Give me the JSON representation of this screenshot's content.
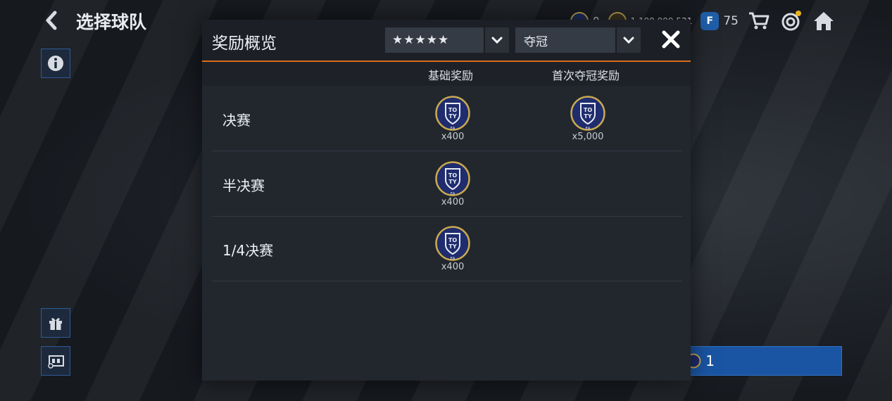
{
  "page": {
    "title": "选择球队",
    "back_icon": "chevron-left-icon"
  },
  "topbar": {
    "currencies": [
      {
        "icon": "toty-token-icon",
        "value": "0"
      },
      {
        "icon": "coin-icon",
        "value": "1,199,999,521"
      },
      {
        "icon": "fc-points-icon",
        "badge_letter": "F",
        "value": "75"
      }
    ],
    "icons": [
      "cart-icon",
      "target-icon",
      "home-icon"
    ]
  },
  "side_buttons": [
    "info-icon",
    "gift-icon",
    "match-icon"
  ],
  "background_button": {
    "value": "1"
  },
  "modal": {
    "title": "奖励概览",
    "difficulty": {
      "stars": "★★★★★",
      "rating": 5
    },
    "stage_select": {
      "value": "夺冠"
    },
    "columns": {
      "base": "基础奖励",
      "first_win": "首次夺冠奖励"
    },
    "rows": [
      {
        "label": "决赛",
        "base_qty": "x400",
        "first_qty": "x5,000"
      },
      {
        "label": "半决赛",
        "base_qty": "x400",
        "first_qty": ""
      },
      {
        "label": "1/4决赛",
        "base_qty": "x400",
        "first_qty": ""
      }
    ],
    "badge_text": {
      "top": "TO",
      "bottom": "TY",
      "brand": "EA"
    }
  },
  "colors": {
    "accent_orange": "#d86d1d",
    "star_gold": "#f0b420",
    "button_blue": "#1a55a3",
    "badge_navy": "#1f2c6e",
    "badge_gold": "#c9a94e"
  }
}
